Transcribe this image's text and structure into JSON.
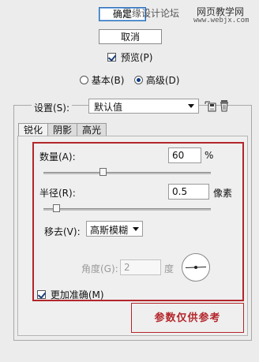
{
  "watermark": {
    "left": "思缘设计论坛",
    "right_top": "网页教学网",
    "right_bottom": "www.webjx.com"
  },
  "buttons": {
    "ok": "确定",
    "cancel": "取消"
  },
  "preview": {
    "label": "预览(P)",
    "checked": true
  },
  "mode": {
    "basic": "基本(B)",
    "advanced": "高级(D)",
    "selected": "advanced"
  },
  "settings": {
    "label": "设置(S):",
    "value": "默认值"
  },
  "tabs": [
    {
      "label": "锐化",
      "active": true
    },
    {
      "label": "阴影",
      "active": false
    },
    {
      "label": "高光",
      "active": false
    }
  ],
  "amount": {
    "label": "数量(A):",
    "value": "60",
    "unit": "%",
    "slider_level": 0.35
  },
  "radius": {
    "label": "半径(R):",
    "value": "0.5",
    "unit": "像素",
    "slider_level": 0.06
  },
  "remove": {
    "label": "移去(V):",
    "value": "高斯模糊"
  },
  "angle": {
    "label": "角度(G):",
    "value": "2",
    "unit": "度"
  },
  "more_accurate": {
    "label": "更加准确(M)",
    "checked": true
  },
  "note": "参数仅供参考",
  "colors": {
    "highlight": "#b3262b",
    "focus": "#2a6db7"
  }
}
